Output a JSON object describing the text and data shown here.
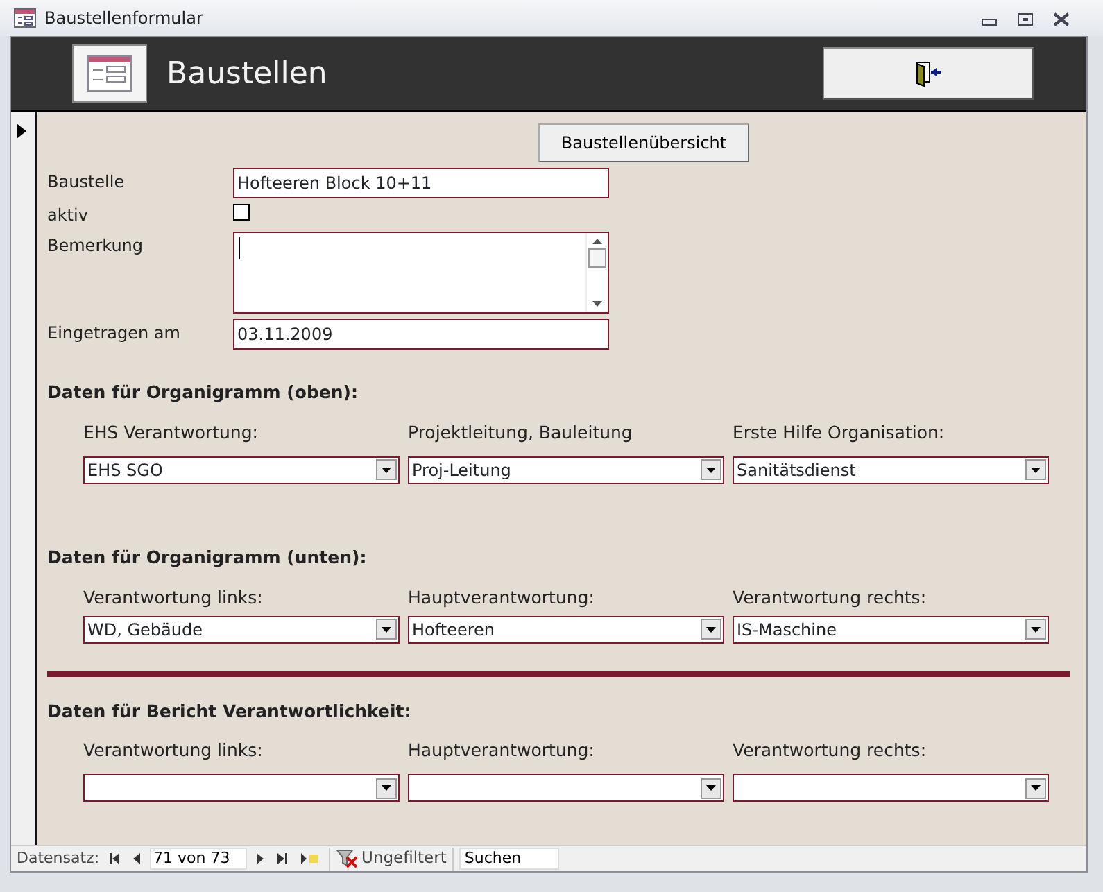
{
  "window": {
    "title": "Baustellenformular"
  },
  "header": {
    "title": "Baustellen"
  },
  "overview_button": "Baustellenübersicht",
  "fields": [
    {
      "kind": "text",
      "label": "Baustelle",
      "value": "Hofteeren Block 10+11"
    },
    {
      "kind": "checkbox",
      "label": "aktiv",
      "checked": false
    },
    {
      "kind": "memo",
      "label": "Bemerkung"
    },
    {
      "kind": "text",
      "label": "Eingetragen am",
      "value": "03.11.2009"
    }
  ],
  "sections": [
    {
      "title": "Daten für Organigramm (oben):",
      "rule_above": false,
      "combos": [
        {
          "label": "EHS Verantwortung:",
          "value": "EHS SGO"
        },
        {
          "label": "Projektleitung, Bauleitung",
          "value": "Proj-Leitung"
        },
        {
          "label": "Erste Hilfe Organisation:",
          "value": "Sanitätsdienst"
        }
      ]
    },
    {
      "title": "Daten für Organigramm (unten):",
      "rule_above": false,
      "combos": [
        {
          "label": "Verantwortung links:",
          "value": "WD, Gebäude"
        },
        {
          "label": "Hauptverantwortung:",
          "value": "Hofteeren"
        },
        {
          "label": "Verantwortung rechts:",
          "value": "IS-Maschine"
        }
      ]
    },
    {
      "title": "Daten für Bericht Verantwortlichkeit:",
      "rule_above": true,
      "combos": [
        {
          "label": "Verantwortung links:"
        },
        {
          "label": "Hauptverantwortung:"
        },
        {
          "label": "Verantwortung rechts:"
        }
      ]
    }
  ],
  "record_nav": {
    "label": "Datensatz:",
    "position": "71 von 73",
    "filter": "Ungefiltert",
    "search": "Suchen"
  }
}
